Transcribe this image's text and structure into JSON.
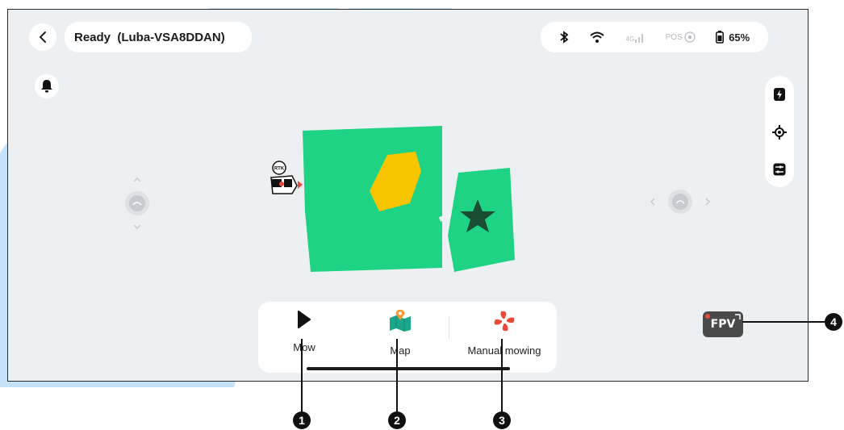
{
  "header": {
    "title": "Ready  (Luba-VSA8DDAN)",
    "back_icon": "chevron-left-icon"
  },
  "status": {
    "signal_label": "4G",
    "pos_label": "POS",
    "battery_percent": "65%"
  },
  "map": {
    "zones": [
      "green-zone-large",
      "green-zone-small"
    ],
    "obstacle_color": "#f6c500",
    "zone_color": "#1fd385",
    "star_color": "#1b4d33",
    "rtk_label": "RTK"
  },
  "toolbar": {
    "mow_label": "Mow",
    "map_label": "Map",
    "manual_label": "Manual mowing"
  },
  "fpv_label": "FPV",
  "callouts": [
    "1",
    "2",
    "3",
    "4"
  ],
  "colors": {
    "background": "#edf0f2",
    "accent_red": "#e84a3c",
    "map_icon_orange": "#f29a2e",
    "map_icon_teal": "#1aa689"
  }
}
